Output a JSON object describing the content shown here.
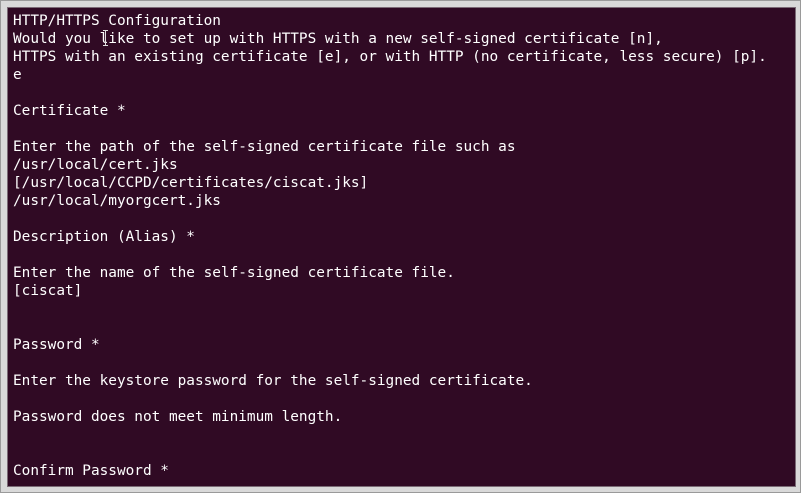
{
  "terminal": {
    "lines": [
      "HTTP/HTTPS Configuration",
      "Would you like to set up with HTTPS with a new self-signed certificate [n],",
      "HTTPS with an existing certificate [e], or with HTTP (no certificate, less secure) [p].",
      "e",
      "",
      "Certificate *",
      "",
      "Enter the path of the self-signed certificate file such as",
      "/usr/local/cert.jks",
      "[/usr/local/CCPD/certificates/ciscat.jks]",
      "/usr/local/myorgcert.jks",
      "",
      "Description (Alias) *",
      "",
      "Enter the name of the self-signed certificate file.",
      "[ciscat]",
      "",
      "",
      "Password *",
      "",
      "Enter the keystore password for the self-signed certificate.",
      "",
      "Password does not meet minimum length.",
      "",
      "",
      "Confirm Password *"
    ]
  },
  "colors": {
    "background": "#300a24",
    "text": "#ffffff"
  },
  "icons": {
    "mouse_pointer": "text-cursor-ibeam-icon"
  }
}
